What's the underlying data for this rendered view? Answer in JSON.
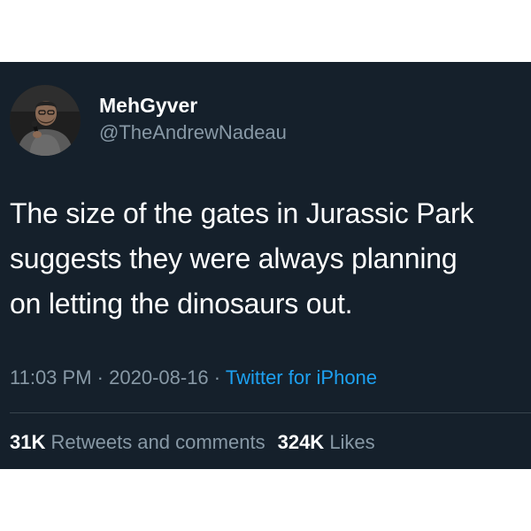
{
  "colors": {
    "background": "#15202b",
    "text_primary": "#ffffff",
    "text_secondary": "#8899a6",
    "link": "#1da1f2",
    "divider": "#38444d"
  },
  "author": {
    "display_name": "MehGyver",
    "handle": "@TheAndrewNadeau",
    "avatar_icon": "avatar-photo-man-with-microphone"
  },
  "tweet": {
    "text_lines": [
      "The size of the gates in Jurassic Park",
      "suggests they were always planning",
      "on letting the dinosaurs out."
    ],
    "time": "11:03 PM",
    "separator": "·",
    "date": "2020-08-16",
    "source": "Twitter for iPhone"
  },
  "stats": {
    "retweets_count": "31K",
    "retweets_label": "Retweets and comments",
    "likes_count": "324K",
    "likes_label": "Likes"
  }
}
